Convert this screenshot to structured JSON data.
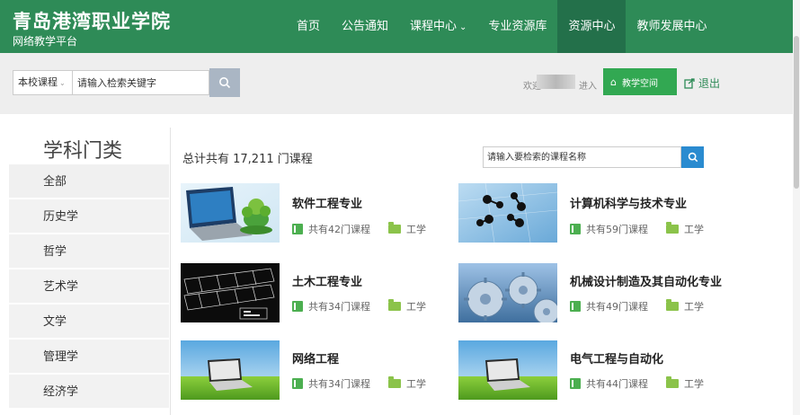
{
  "header": {
    "brand_title": "青岛港湾职业学院",
    "brand_subtitle": "网络教学平台",
    "nav": [
      {
        "label": "首页"
      },
      {
        "label": "公告通知"
      },
      {
        "label": "课程中心"
      },
      {
        "label": "专业资源库"
      },
      {
        "label": "资源中心"
      },
      {
        "label": "教师发展中心"
      }
    ],
    "active_nav": "资源中心"
  },
  "search": {
    "scope_value": "本校课程",
    "keyword_placeholder": "请输入检索关键字",
    "welcome_text": "欢迎",
    "enter_text": "进入",
    "space_button_label": "教学空间",
    "logout_label": "退出"
  },
  "sidebar": {
    "title": "学科门类",
    "items": [
      {
        "label": "全部"
      },
      {
        "label": "历史学"
      },
      {
        "label": "哲学"
      },
      {
        "label": "艺术学"
      },
      {
        "label": "文学"
      },
      {
        "label": "管理学"
      },
      {
        "label": "经济学"
      }
    ]
  },
  "main": {
    "total_text": "总计共有 17,211 门课程",
    "course_search_placeholder": "请输入要检索的课程名称",
    "courses": [
      {
        "name": "软件工程专业",
        "count": "共有42门课程",
        "category": "工学",
        "image": "laptop-plant"
      },
      {
        "name": "计算机科学与技术专业",
        "count": "共有59门课程",
        "category": "工学",
        "image": "network-nodes"
      },
      {
        "name": "土木工程专业",
        "count": "共有34门课程",
        "category": "工学",
        "image": "cad-blueprint"
      },
      {
        "name": "机械设计制造及其自动化专业",
        "count": "共有49门课程",
        "category": "工学",
        "image": "gears"
      },
      {
        "name": "网络工程",
        "count": "共有34门课程",
        "category": "工学",
        "image": "laptop-grass"
      },
      {
        "name": "电气工程与自动化",
        "count": "共有44门课程",
        "category": "工学",
        "image": "laptop-grass"
      }
    ]
  },
  "colors": {
    "header_bg": "#2e8b57",
    "active_nav_bg": "#23704a",
    "space_button": "#32a852",
    "search_button": "#2a8bd0"
  }
}
